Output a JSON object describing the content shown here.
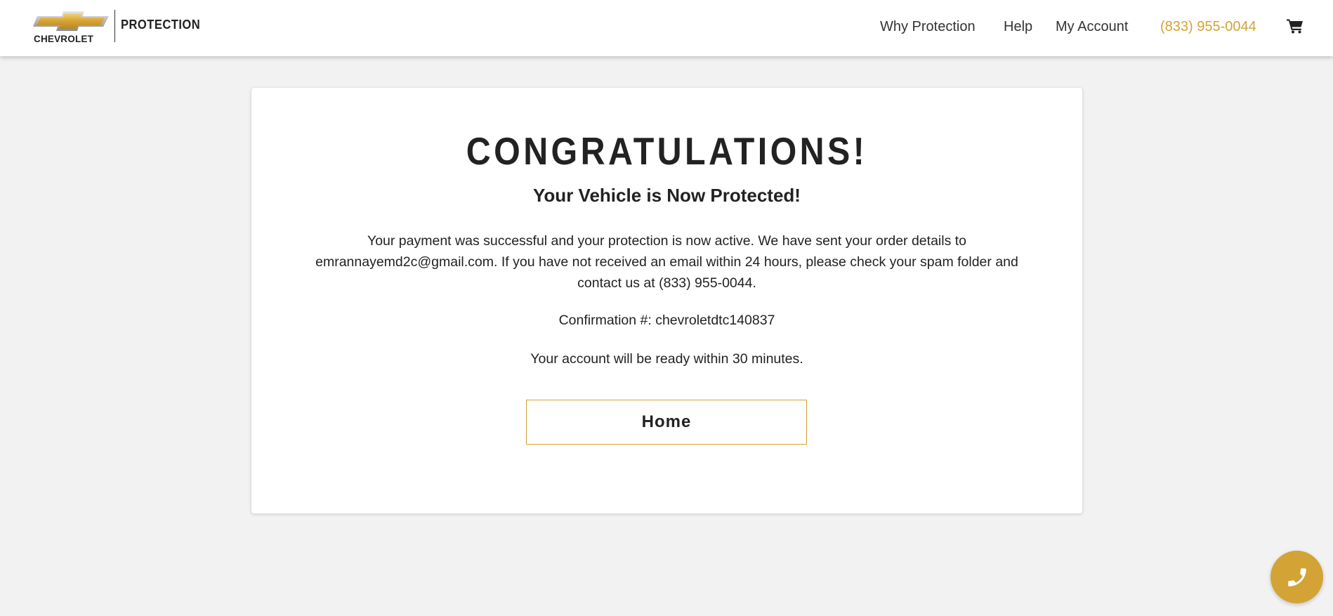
{
  "header": {
    "brand": "CHEVROLET",
    "product": "PROTECTION",
    "nav": [
      {
        "label": "Why Protection"
      },
      {
        "label": "Help"
      },
      {
        "label": "My Account"
      }
    ],
    "phone": "(833) 955-0044",
    "cart_icon": "shopping-cart-icon"
  },
  "main": {
    "title": "CONGRATULATIONS!",
    "subtitle": "Your Vehicle is Now Protected!",
    "message": "Your payment was successful and your protection is now active. We have sent your order details to emrannayemd2c@gmail.com. If you have not received an email within 24 hours, please check your spam folder and contact us at (833) 955-0044.",
    "confirmation": "Confirmation #: chevroletdtc140837",
    "ready_note": "Your account will be ready within 30 minutes.",
    "home_button": "Home"
  },
  "floating": {
    "call_icon": "phone-icon"
  },
  "colors": {
    "accent": "#d3a336",
    "background": "#f2f2f2",
    "text": "#222222"
  }
}
